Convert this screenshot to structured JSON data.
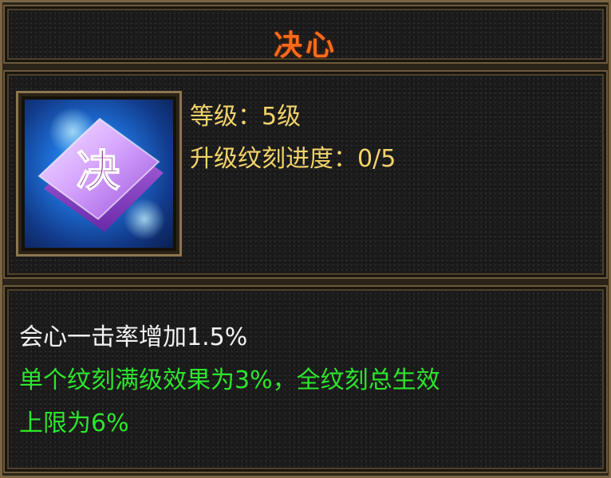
{
  "skill": {
    "title": "决心",
    "icon_glyph": "决",
    "icon_name": "rune-stone-icon",
    "level_text": "等级：5级",
    "progress_text": "升级纹刻进度：0/5"
  },
  "description": {
    "effect_text": "会心一击率增加1.5%",
    "note_line1": "单个纹刻满级效果为3%，全纹刻总生效",
    "note_line2": "上限为6%"
  },
  "colors": {
    "title": "#ff6a1a",
    "stat": "#f3d36a",
    "effect": "#f2f2f2",
    "note": "#2ce62c"
  }
}
